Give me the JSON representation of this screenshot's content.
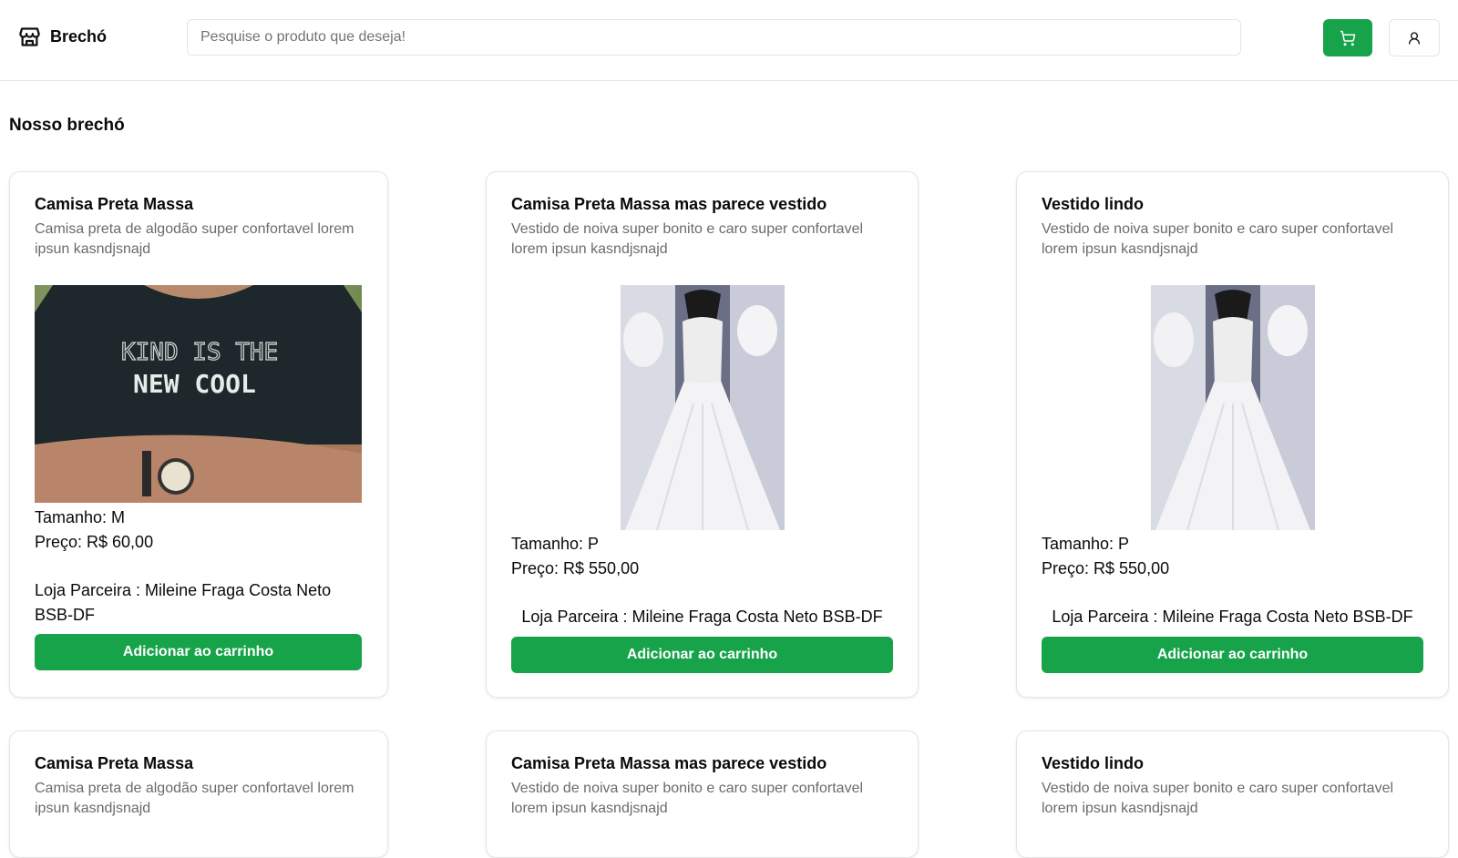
{
  "header": {
    "brand": "Brechó",
    "search_placeholder": "Pesquise o produto que deseja!",
    "cart_icon": "shopping-cart-icon",
    "user_icon": "user-icon",
    "accent": "#16a34a"
  },
  "main": {
    "section_title": "Nosso brechó",
    "products": [
      {
        "title": "Camisa Preta Massa",
        "description": "Camisa preta de algodão super confortavel lorem ipsun kasndjsnajd",
        "image": "black-tshirt-photo",
        "size": "Tamanho: M",
        "price": "Preço: R$ 60,00",
        "partner": "Loja Parceira : Mileine Fraga Costa Neto BSB-DF",
        "button": "Adicionar ao carrinho"
      },
      {
        "title": "Camisa Preta Massa mas parece vestido",
        "description": "Vestido de noiva super bonito e caro super confortavel lorem ipsun kasndjsnajd",
        "image": "wedding-dress-photo",
        "size": "Tamanho: P",
        "price": "Preço: R$ 550,00",
        "partner": "Loja Parceira : Mileine Fraga Costa Neto BSB-DF",
        "button": "Adicionar ao carrinho"
      },
      {
        "title": "Vestido lindo",
        "description": "Vestido de noiva super bonito e caro super confortavel lorem ipsun kasndjsnajd",
        "image": "wedding-dress-photo",
        "size": "Tamanho: P",
        "price": "Preço: R$ 550,00",
        "partner": "Loja Parceira : Mileine Fraga Costa Neto BSB-DF",
        "button": "Adicionar ao carrinho"
      },
      {
        "title": "Camisa Preta Massa",
        "description": "Camisa preta de algodão super confortavel lorem ipsun kasndjsnajd"
      },
      {
        "title": "Camisa Preta Massa mas parece vestido",
        "description": "Vestido de noiva super bonito e caro super confortavel lorem ipsun kasndjsnajd"
      },
      {
        "title": "Vestido lindo",
        "description": "Vestido de noiva super bonito e caro super confortavel lorem ipsun kasndjsnajd"
      }
    ]
  }
}
